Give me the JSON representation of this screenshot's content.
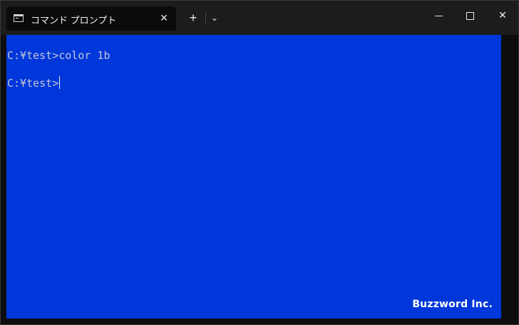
{
  "window": {
    "tab_title": "コマンド プロンプト",
    "tab_close_glyph": "✕",
    "new_tab_glyph": "+",
    "dropdown_glyph": "⌄",
    "close_glyph": "✕"
  },
  "terminal": {
    "background_color": "#0037da",
    "text_color": "#c0c6d9",
    "lines": [
      "C:¥test>color 1b",
      "C:¥test>"
    ]
  },
  "watermark": "Buzzword Inc.",
  "icons": [
    "cmd-icon",
    "close-icon",
    "plus-icon",
    "chevron-down-icon",
    "minimize-icon",
    "maximize-icon"
  ]
}
